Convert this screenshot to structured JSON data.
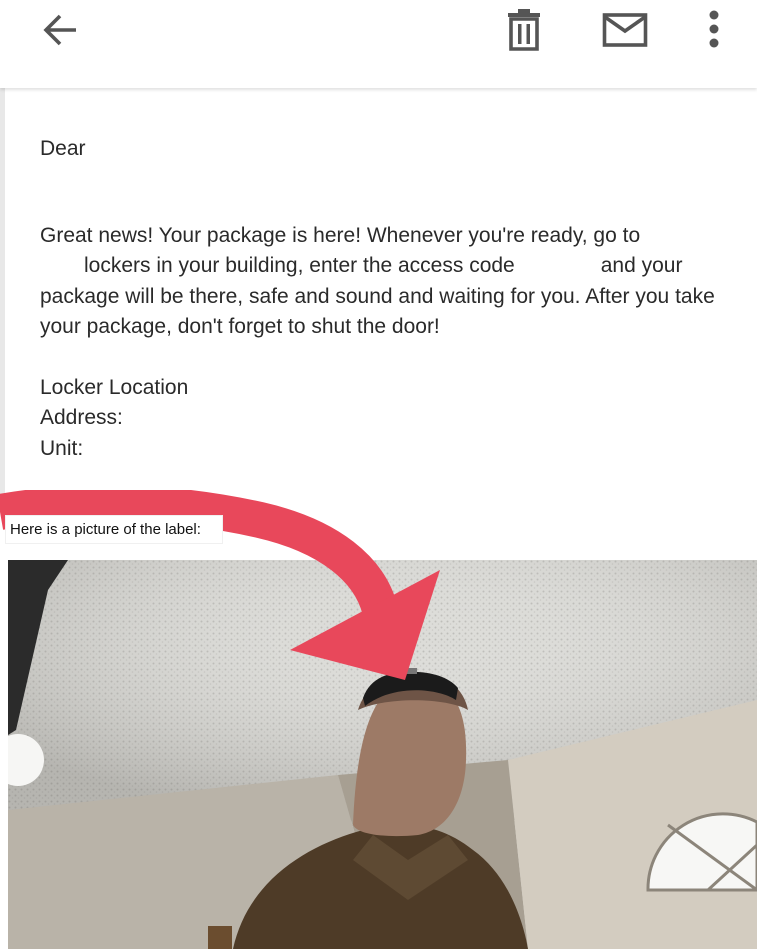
{
  "appbar": {
    "back_icon": "arrow-back-icon",
    "delete_icon": "trash-icon",
    "mail_icon": "envelope-icon",
    "more_icon": "more-vertical-icon"
  },
  "email": {
    "greeting": "Dear",
    "message_line1": "Great news! Your package is here! Whenever you're ready, go to",
    "message_line2a": "lockers in your building, enter the access code",
    "message_line2b": "and your",
    "message_rest": "package will be there, safe and sound and waiting for you. After you take your package, don't forget to shut the door!",
    "locker_location": "Locker Location",
    "address_label": "Address:",
    "unit_label": "Unit:"
  },
  "annotation": {
    "label_text": "Here is a picture of the label:",
    "arrow_color": "#e8485b"
  },
  "photo": {
    "description_icon": "photo-image"
  }
}
